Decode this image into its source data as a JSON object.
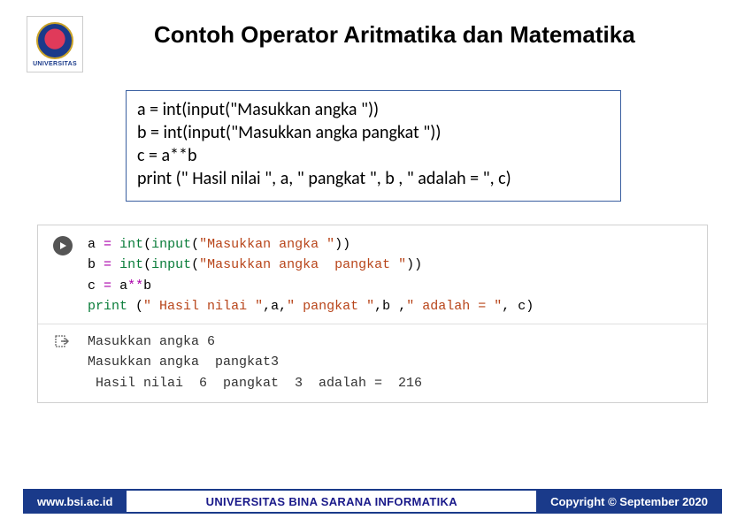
{
  "logo": {
    "label": "UNIVERSITAS"
  },
  "title": "Contoh Operator Aritmatika dan Matematika",
  "code_box": {
    "line1": "a = int(input(\"Masukkan angka \"))",
    "line2": "b = int(input(\"Masukkan angka  pangkat \"))",
    "line3": "c = a**b",
    "line4": "print (\" Hasil nilai \", a, \" pangkat \", b , \" adalah = \", c)"
  },
  "ide": {
    "line1": {
      "var": "a",
      "op": "=",
      "fn1": "int",
      "fn2": "input",
      "str": "\"Masukkan angka \""
    },
    "line2": {
      "var": "b",
      "op": "=",
      "fn1": "int",
      "fn2": "input",
      "str": "\"Masukkan angka  pangkat \""
    },
    "line3": {
      "var": "c",
      "op": "=",
      "lhs": "a",
      "pow": "**",
      "rhs": "b"
    },
    "line4": {
      "fn": "print",
      "s1": "\" Hasil nilai \"",
      "v1": "a",
      "s2": "\" pangkat \"",
      "v2": "b",
      "s3": "\" adalah = \"",
      "v3": "c"
    }
  },
  "output": {
    "line1": "Masukkan angka 6",
    "line2": "Masukkan angka  pangkat3",
    "line3": " Hasil nilai  6  pangkat  3  adalah =  216"
  },
  "footer": {
    "left": "www.bsi.ac.id",
    "mid": "UNIVERSITAS BINA SARANA INFORMATIKA",
    "right": "Copyright © September 2020"
  }
}
